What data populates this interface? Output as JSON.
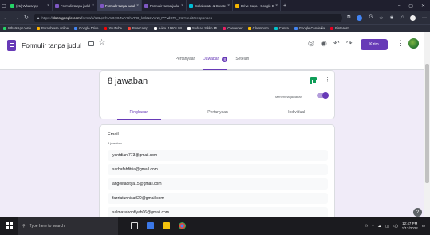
{
  "browser": {
    "tabs": [
      {
        "label": "(21) WhatsApp",
        "color": "#25d366",
        "active": false
      },
      {
        "label": "Formulir tanpa judul - Go",
        "color": "#7e57c2",
        "active": false
      },
      {
        "label": "Formulir tanpa judul -",
        "color": "#7e57c2",
        "active": true
      },
      {
        "label": "Formulir tanpa judul -",
        "color": "#7e57c2",
        "active": false
      },
      {
        "label": "Collaborate & Create",
        "color": "#00bcd4",
        "active": false
      },
      {
        "label": "Drive Saya - Google D",
        "color": "#f4b400",
        "active": false
      }
    ],
    "new_tab": "+",
    "url_prefix": "https://",
    "url_domain": "docs.google.com",
    "url_rest": "/forms/d/13LpXhVsOrjGZwYGhYPD_k8kNzVxNt_PPvdCTs_tX2Y/edit#responses",
    "bookmarks": [
      {
        "label": "WhatsApp Web",
        "color": "#25d366"
      },
      {
        "label": "Paraphrase online",
        "color": "#ffb300"
      },
      {
        "label": "Google Drive",
        "color": "#4285f4"
      },
      {
        "label": "YouTube",
        "color": "#ff0000"
      },
      {
        "label": "Basecamp",
        "color": "#f44336"
      },
      {
        "label": "e-lea. 19601 MI",
        "color": "#ffffff"
      },
      {
        "label": "Sudsad Sikko MI",
        "color": "#ffffff"
      },
      {
        "label": "Converter",
        "color": "#e91e63"
      },
      {
        "label": "Classroom",
        "color": "#fbbc04"
      },
      {
        "label": "Canva",
        "color": "#00c4cc"
      },
      {
        "label": "Google Cendekia",
        "color": "#4285f4"
      },
      {
        "label": "Pinterest",
        "color": "#e60023"
      }
    ]
  },
  "form": {
    "title": "Formulir tanpa judul",
    "send_label": "Kirim",
    "tabs": [
      {
        "label": "Pertanyaan",
        "active": false
      },
      {
        "label": "Jawaban",
        "active": true,
        "badge": "8"
      },
      {
        "label": "Setelan",
        "active": false
      }
    ],
    "accent": "#673ab7"
  },
  "summary": {
    "response_count": "8 jawaban",
    "accepting_label": "Menerima jawaban",
    "accepting_on": true,
    "sub_tabs": [
      {
        "label": "Ringkasan",
        "active": true
      },
      {
        "label": "Pertanyaan",
        "active": false
      },
      {
        "label": "Individual",
        "active": false
      }
    ]
  },
  "email_question": {
    "title": "Email",
    "count": "8 jawaban",
    "answers": [
      "yantdiani773@gmail.com",
      "sarhafahfitria@gmail.com",
      "angelitaditya15@gmail.com",
      "fazriatunnisa020@gmail.com",
      "salmasahoofiyah06@gmail.com"
    ]
  },
  "taskbar": {
    "search_placeholder": "Type here to search",
    "time": "12:47 PM",
    "date": "1/12/2022"
  }
}
